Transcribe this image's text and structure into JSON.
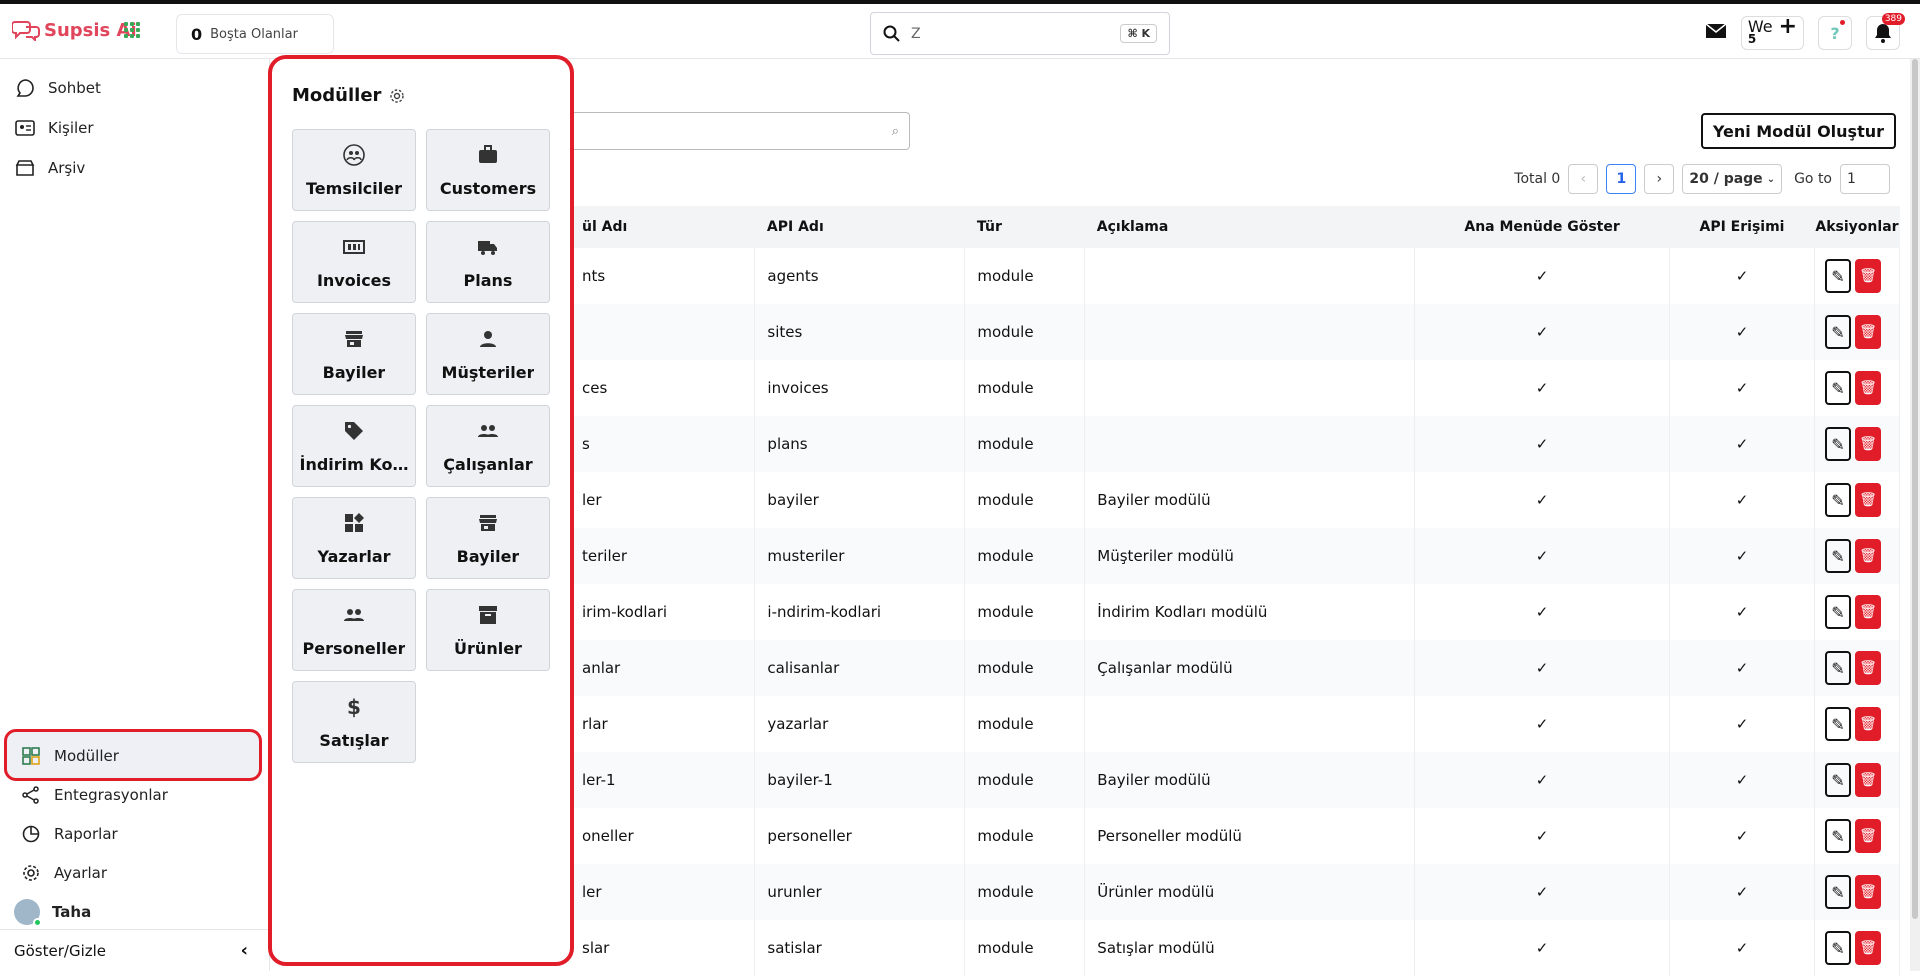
{
  "topbar": {
    "brand": "Supsis Ai",
    "idle_count": "0",
    "idle_label": "Boşta Olanlar",
    "search_value": "Z",
    "search_shortcut": "⌘ K",
    "workspace": "We",
    "workspace_count": "5",
    "notification_count": "389"
  },
  "sidebar": {
    "items": [
      {
        "label": "Sohbet"
      },
      {
        "label": "Kişiler"
      },
      {
        "label": "Arşiv"
      },
      {
        "label": "Modüller"
      },
      {
        "label": "Entegrasyonlar"
      },
      {
        "label": "Raporlar"
      },
      {
        "label": "Ayarlar"
      },
      {
        "label": "Taha"
      }
    ],
    "toggle": "Göster/Gizle"
  },
  "popup": {
    "title": "Modüller",
    "modules": [
      {
        "label": "Temsilciler",
        "icon": "people-circle-icon"
      },
      {
        "label": "Customers",
        "icon": "briefcase-icon"
      },
      {
        "label": "Invoices",
        "icon": "counter-icon"
      },
      {
        "label": "Plans",
        "icon": "truck-icon"
      },
      {
        "label": "Bayiler",
        "icon": "store-icon"
      },
      {
        "label": "Müşteriler",
        "icon": "person-icon"
      },
      {
        "label": "İndirim Ko…",
        "icon": "tag-icon"
      },
      {
        "label": "Çalışanlar",
        "icon": "group-icon"
      },
      {
        "label": "Yazarlar",
        "icon": "widgets-icon"
      },
      {
        "label": "Bayiler",
        "icon": "store-icon"
      },
      {
        "label": "Personeller",
        "icon": "group-icon"
      },
      {
        "label": "Ürünler",
        "icon": "archive-icon"
      },
      {
        "label": "Satışlar",
        "icon": "dollar-icon"
      }
    ]
  },
  "main": {
    "new_module_button": "Yeni Modül Oluştur",
    "pager": {
      "total": "Total 0",
      "page": "1",
      "per_page": "20 / page",
      "goto_label": "Go to",
      "goto_value": "1"
    },
    "columns": [
      "ül Adı",
      "API Adı",
      "Tür",
      "Açıklama",
      "Ana Menüde Göster",
      "API Erişimi",
      "Aksiyonlar"
    ],
    "rows": [
      [
        "nts",
        "agents",
        "module",
        ""
      ],
      [
        "",
        "sites",
        "module",
        ""
      ],
      [
        "ces",
        "invoices",
        "module",
        ""
      ],
      [
        "s",
        "plans",
        "module",
        ""
      ],
      [
        "ler",
        "bayiler",
        "module",
        "Bayiler modülü"
      ],
      [
        "teriler",
        "musteriler",
        "module",
        "Müşteriler modülü"
      ],
      [
        "irim-kodlari",
        "i-ndirim-kodlari",
        "module",
        "İndirim Kodları modülü"
      ],
      [
        "anlar",
        "calisanlar",
        "module",
        "Çalışanlar modülü"
      ],
      [
        "rlar",
        "yazarlar",
        "module",
        ""
      ],
      [
        "ler-1",
        "bayiler-1",
        "module",
        "Bayiler modülü"
      ],
      [
        "oneller",
        "personeller",
        "module",
        "Personeller modülü"
      ],
      [
        "ler",
        "urunler",
        "module",
        "Ürünler modülü"
      ],
      [
        "slar",
        "satislar",
        "module",
        "Satışlar modülü"
      ]
    ]
  }
}
